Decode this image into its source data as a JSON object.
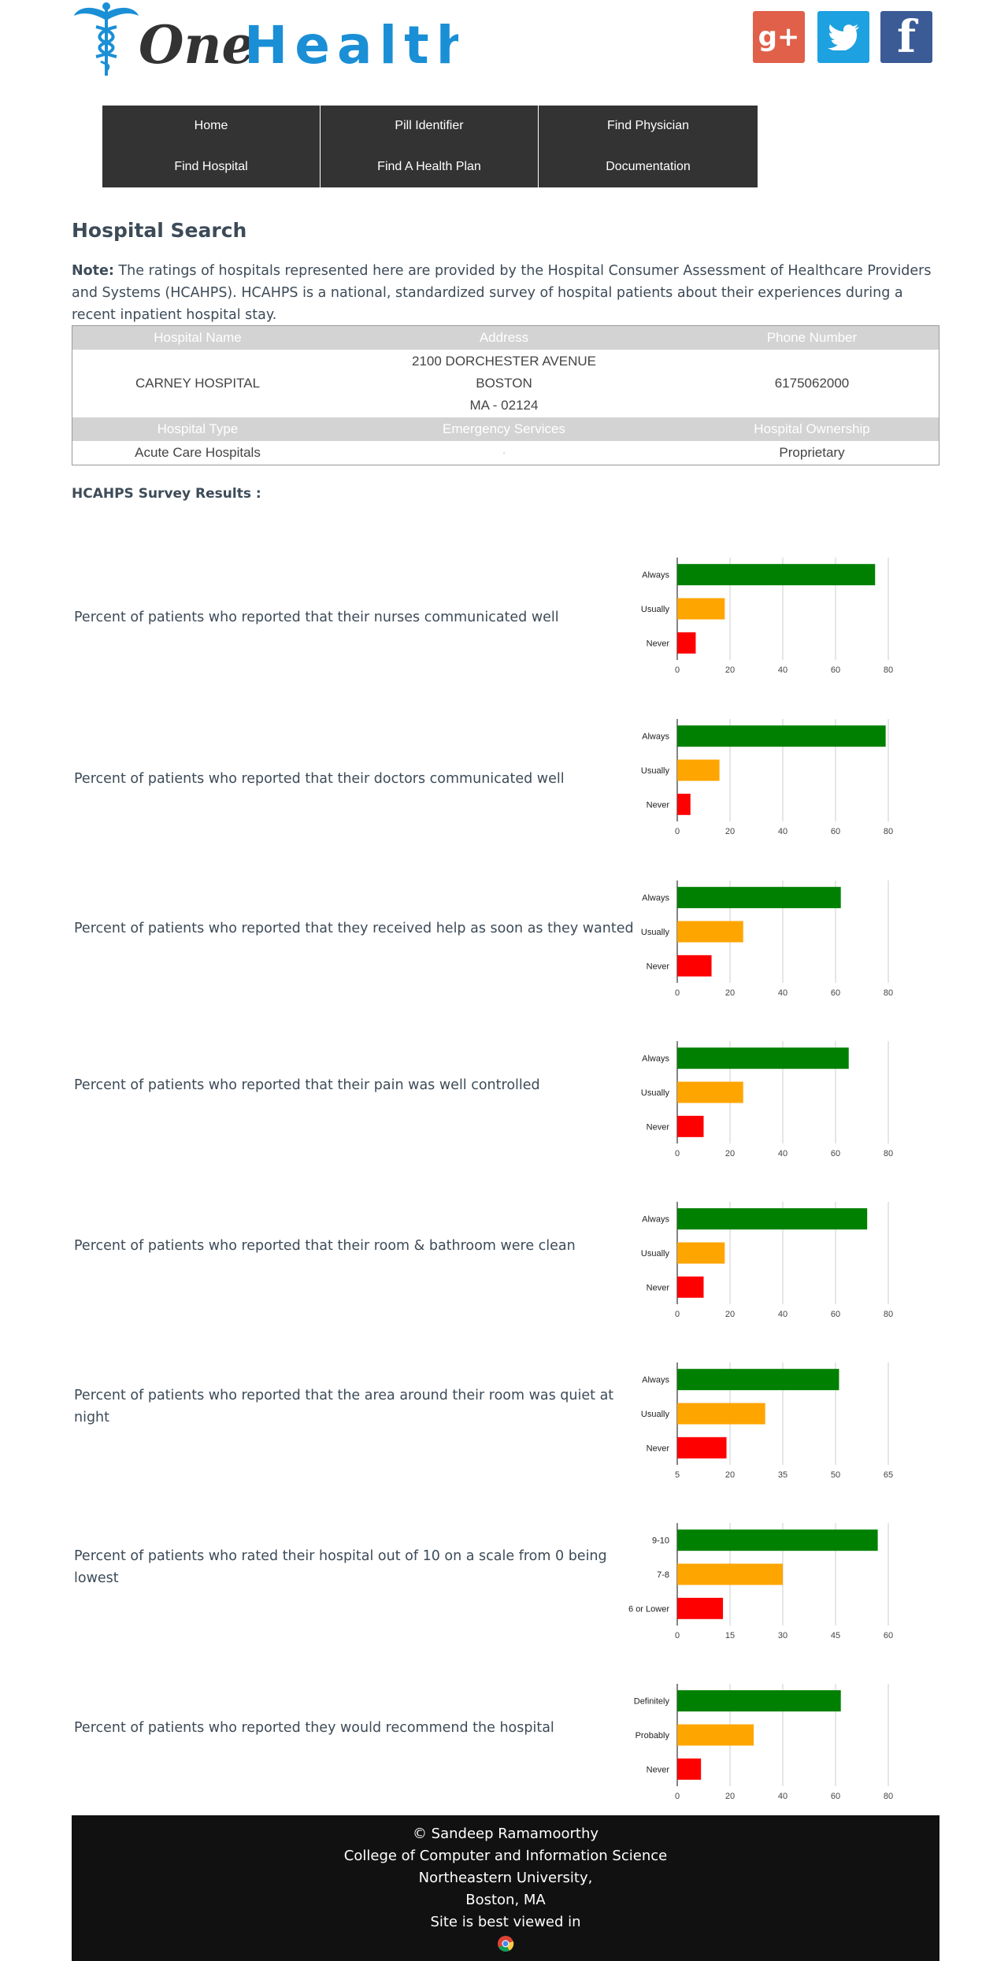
{
  "brand": {
    "logo_one": "One",
    "logo_health": "Health"
  },
  "social": [
    {
      "name": "gplus",
      "label": "g+"
    },
    {
      "name": "twitter",
      "label": ""
    },
    {
      "name": "facebook",
      "label": "f"
    }
  ],
  "nav": {
    "home": "Home",
    "pill_identifier": "Pill Identifier",
    "find_physician": "Find Physician",
    "find_hospital": "Find Hospital",
    "find_health_plan": "Find A Health Plan",
    "documentation": "Documentation"
  },
  "page_title": "Hospital Search",
  "note": {
    "label": "Note:",
    "text": " The ratings of hospitals represented here are provided by the Hospital Consumer Assessment of Healthcare Providers and Systems (HCAHPS). HCAHPS is a national, standardized survey of hospital patients about their experiences during a recent inpatient hospital stay."
  },
  "hospital": {
    "headers": {
      "name": "Hospital Name",
      "address": "Address",
      "phone": "Phone Number",
      "type": "Hospital Type",
      "emergency": "Emergency Services",
      "ownership": "Hospital Ownership"
    },
    "name": "CARNEY HOSPITAL",
    "address_line1": "2100 DORCHESTER AVENUE",
    "address_line2": "BOSTON",
    "address_line3": "MA - 02124",
    "phone": "6175062000",
    "type": "Acute Care Hospitals",
    "emergency": "",
    "ownership": "Proprietary"
  },
  "survey_title": "HCAHPS Survey Results :",
  "colors": {
    "green": "#008000",
    "orange": "#ffa500",
    "red": "#ff0000",
    "grid": "#cccccc"
  },
  "chart_data": [
    {
      "type": "bar",
      "question": "Percent of patients who reported that their nurses communicated well",
      "categories": [
        "Always",
        "Usually",
        "Never"
      ],
      "values": [
        75,
        18,
        7
      ],
      "xlim": [
        0,
        80
      ],
      "ticks": [
        0,
        20,
        40,
        60,
        80
      ]
    },
    {
      "type": "bar",
      "question": "Percent of patients who reported that their doctors communicated well",
      "categories": [
        "Always",
        "Usually",
        "Never"
      ],
      "values": [
        79,
        16,
        5
      ],
      "xlim": [
        0,
        80
      ],
      "ticks": [
        0,
        20,
        40,
        60,
        80
      ]
    },
    {
      "type": "bar",
      "question": "Percent of patients who reported that they received help as soon as they wanted",
      "categories": [
        "Always",
        "Usually",
        "Never"
      ],
      "values": [
        62,
        25,
        13
      ],
      "xlim": [
        0,
        80
      ],
      "ticks": [
        0,
        20,
        40,
        60,
        80
      ]
    },
    {
      "type": "bar",
      "question": "Percent of patients who reported that their pain was well controlled",
      "categories": [
        "Always",
        "Usually",
        "Never"
      ],
      "values": [
        65,
        25,
        10
      ],
      "xlim": [
        0,
        80
      ],
      "ticks": [
        0,
        20,
        40,
        60,
        80
      ]
    },
    {
      "type": "bar",
      "question": "Percent of patients who reported that their room & bathroom were clean",
      "categories": [
        "Always",
        "Usually",
        "Never"
      ],
      "values": [
        72,
        18,
        10
      ],
      "xlim": [
        0,
        80
      ],
      "ticks": [
        0,
        20,
        40,
        60,
        80
      ]
    },
    {
      "type": "bar",
      "question": "Percent of patients who reported that the area around their room was quiet at night",
      "categories": [
        "Always",
        "Usually",
        "Never"
      ],
      "values": [
        51,
        30,
        19
      ],
      "xlim": [
        5,
        65
      ],
      "ticks": [
        5,
        20,
        35,
        50,
        65
      ]
    },
    {
      "type": "bar",
      "question": "Percent of patients who rated their hospital out of 10 on a scale from 0 being lowest",
      "categories": [
        "9-10",
        "7-8",
        "6 or Lower"
      ],
      "values": [
        57,
        30,
        13
      ],
      "xlim": [
        0,
        60
      ],
      "ticks": [
        0,
        15,
        30,
        45,
        60
      ]
    },
    {
      "type": "bar",
      "question": "Percent of patients who reported they would recommend the hospital",
      "categories": [
        "Definitely",
        "Probably",
        "Never"
      ],
      "values": [
        62,
        29,
        9
      ],
      "xlim": [
        0,
        80
      ],
      "ticks": [
        0,
        20,
        40,
        60,
        80
      ]
    }
  ],
  "footer": {
    "line1": "© Sandeep Ramamoorthy",
    "line2": "College of Computer and Information Science",
    "line3": "Northeastern University,",
    "line4": "Boston, MA",
    "line5": "Site is best viewed in"
  }
}
